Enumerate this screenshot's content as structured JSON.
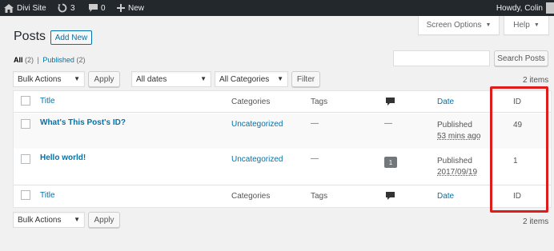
{
  "adminbar": {
    "site_name": "Divi Site",
    "updates_count": "3",
    "comments_count": "0",
    "new_label": "New",
    "greeting": "Howdy, Colin"
  },
  "screen_options": {
    "screen_options_label": "Screen Options",
    "help_label": "Help"
  },
  "header": {
    "title": "Posts",
    "add_new_label": "Add New"
  },
  "views": {
    "all_label": "All",
    "all_count": "(2)",
    "separator": "|",
    "published_label": "Published",
    "published_count": "(2)"
  },
  "search": {
    "button_label": "Search Posts"
  },
  "filters": {
    "bulk_actions": "Bulk Actions",
    "apply_label": "Apply",
    "dates": "All dates",
    "categories": "All Categories",
    "filter_label": "Filter"
  },
  "items_count": "2 items",
  "table": {
    "columns": {
      "title": "Title",
      "categories": "Categories",
      "tags": "Tags",
      "date": "Date",
      "id": "ID"
    },
    "rows": [
      {
        "title": "What's This Post's ID?",
        "category": "Uncategorized",
        "tags": "—",
        "comments": "—",
        "status": "Published",
        "date": "53 mins ago",
        "id": "49"
      },
      {
        "title": "Hello world!",
        "category": "Uncategorized",
        "tags": "—",
        "comments": "1",
        "status": "Published",
        "date": "2017/09/19",
        "id": "1"
      }
    ]
  },
  "bottom": {
    "bulk_actions": "Bulk Actions",
    "apply_label": "Apply",
    "items_count": "2 items"
  },
  "colors": {
    "link": "#0073aa",
    "adminbar_bg": "#23282d",
    "highlight": "#e01b1b"
  }
}
